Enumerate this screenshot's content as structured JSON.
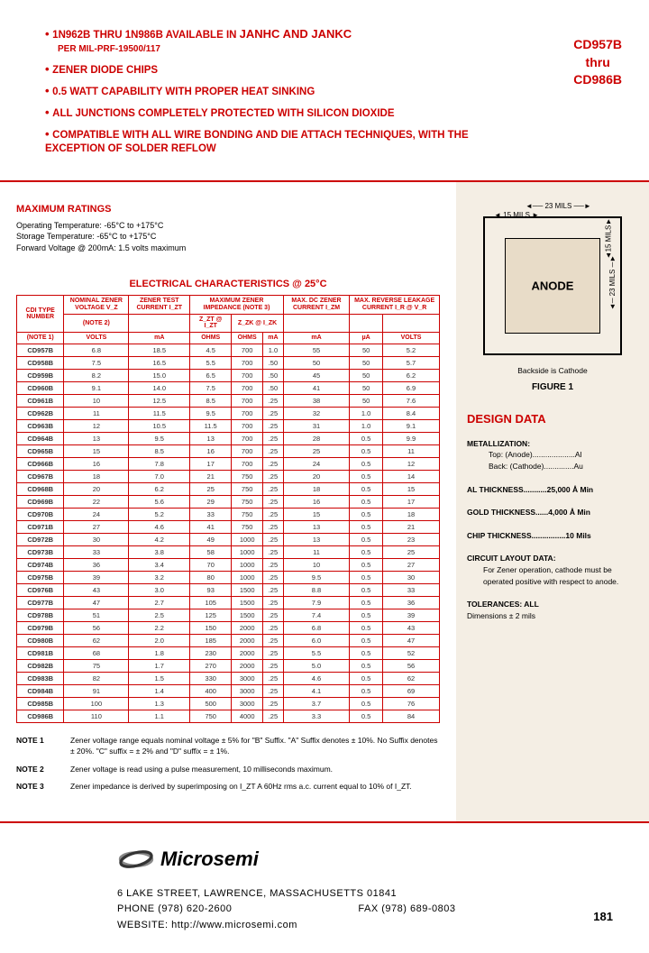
{
  "title": {
    "a": "CD957B",
    "b": "thru",
    "c": "CD986B"
  },
  "features": [
    "1N962B THRU 1N986B AVAILABLE IN JANHC AND JANKC PER MIL-PRF-19500/117",
    "ZENER DIODE CHIPS",
    "0.5 WATT CAPABILITY WITH PROPER HEAT SINKING",
    "ALL JUNCTIONS COMPLETELY PROTECTED WITH SILICON DIOXIDE",
    "COMPATIBLE WITH ALL WIRE BONDING AND DIE ATTACH TECHNIQUES, WITH THE EXCEPTION OF SOLDER REFLOW"
  ],
  "maxratings": {
    "h": "MAXIMUM RATINGS",
    "l1": "Operating Temperature: -65°C to +175°C",
    "l2": "Storage Temperature: -65°C to +175°C",
    "l3": "Forward Voltage @ 200mA: 1.5 volts maximum"
  },
  "ehdr": "ELECTRICAL CHARACTERISTICS @ 25°C",
  "thead": [
    "CDI TYPE NUMBER",
    "NOMINAL ZENER VOLTAGE V_Z",
    "ZENER TEST CURRENT I_ZT",
    "MAXIMUM ZENER IMPEDANCE (NOTE 3)",
    "",
    "MAX. DC ZENER CURRENT I_ZM",
    "MAX. REVERSE LEAKAGE CURRENT I_R @ V_R",
    ""
  ],
  "tsub": [
    "(NOTE 1)",
    "(NOTE 2)",
    "",
    "Z_ZT @ I_ZT",
    "Z_ZK @ I_ZK",
    "",
    "",
    ""
  ],
  "units": [
    "",
    "VOLTS",
    "mA",
    "OHMS",
    "OHMS",
    "mA",
    "mA",
    "µA",
    "VOLTS"
  ],
  "rows": [
    [
      "CD957B",
      "6.8",
      "18.5",
      "4.5",
      "700",
      "1.0",
      "55",
      "50",
      "5.2"
    ],
    [
      "CD958B",
      "7.5",
      "16.5",
      "5.5",
      "700",
      ".50",
      "50",
      "50",
      "5.7"
    ],
    [
      "CD959B",
      "8.2",
      "15.0",
      "6.5",
      "700",
      ".50",
      "45",
      "50",
      "6.2"
    ],
    [
      "CD960B",
      "9.1",
      "14.0",
      "7.5",
      "700",
      ".50",
      "41",
      "50",
      "6.9"
    ],
    [
      "CD961B",
      "10",
      "12.5",
      "8.5",
      "700",
      ".25",
      "38",
      "50",
      "7.6"
    ],
    [
      "CD962B",
      "11",
      "11.5",
      "9.5",
      "700",
      ".25",
      "32",
      "1.0",
      "8.4"
    ],
    [
      "CD963B",
      "12",
      "10.5",
      "11.5",
      "700",
      ".25",
      "31",
      "1.0",
      "9.1"
    ],
    [
      "CD964B",
      "13",
      "9.5",
      "13",
      "700",
      ".25",
      "28",
      "0.5",
      "9.9"
    ],
    [
      "CD965B",
      "15",
      "8.5",
      "16",
      "700",
      ".25",
      "25",
      "0.5",
      "11"
    ],
    [
      "CD966B",
      "16",
      "7.8",
      "17",
      "700",
      ".25",
      "24",
      "0.5",
      "12"
    ],
    [
      "CD967B",
      "18",
      "7.0",
      "21",
      "750",
      ".25",
      "20",
      "0.5",
      "14"
    ],
    [
      "CD968B",
      "20",
      "6.2",
      "25",
      "750",
      ".25",
      "18",
      "0.5",
      "15"
    ],
    [
      "CD969B",
      "22",
      "5.6",
      "29",
      "750",
      ".25",
      "16",
      "0.5",
      "17"
    ],
    [
      "CD970B",
      "24",
      "5.2",
      "33",
      "750",
      ".25",
      "15",
      "0.5",
      "18"
    ],
    [
      "CD971B",
      "27",
      "4.6",
      "41",
      "750",
      ".25",
      "13",
      "0.5",
      "21"
    ],
    [
      "CD972B",
      "30",
      "4.2",
      "49",
      "1000",
      ".25",
      "13",
      "0.5",
      "23"
    ],
    [
      "CD973B",
      "33",
      "3.8",
      "58",
      "1000",
      ".25",
      "11",
      "0.5",
      "25"
    ],
    [
      "CD974B",
      "36",
      "3.4",
      "70",
      "1000",
      ".25",
      "10",
      "0.5",
      "27"
    ],
    [
      "CD975B",
      "39",
      "3.2",
      "80",
      "1000",
      ".25",
      "9.5",
      "0.5",
      "30"
    ],
    [
      "CD976B",
      "43",
      "3.0",
      "93",
      "1500",
      ".25",
      "8.8",
      "0.5",
      "33"
    ],
    [
      "CD977B",
      "47",
      "2.7",
      "105",
      "1500",
      ".25",
      "7.9",
      "0.5",
      "36"
    ],
    [
      "CD978B",
      "51",
      "2.5",
      "125",
      "1500",
      ".25",
      "7.4",
      "0.5",
      "39"
    ],
    [
      "CD979B",
      "56",
      "2.2",
      "150",
      "2000",
      ".25",
      "6.8",
      "0.5",
      "43"
    ],
    [
      "CD980B",
      "62",
      "2.0",
      "185",
      "2000",
      ".25",
      "6.0",
      "0.5",
      "47"
    ],
    [
      "CD981B",
      "68",
      "1.8",
      "230",
      "2000",
      ".25",
      "5.5",
      "0.5",
      "52"
    ],
    [
      "CD982B",
      "75",
      "1.7",
      "270",
      "2000",
      ".25",
      "5.0",
      "0.5",
      "56"
    ],
    [
      "CD983B",
      "82",
      "1.5",
      "330",
      "3000",
      ".25",
      "4.6",
      "0.5",
      "62"
    ],
    [
      "CD984B",
      "91",
      "1.4",
      "400",
      "3000",
      ".25",
      "4.1",
      "0.5",
      "69"
    ],
    [
      "CD985B",
      "100",
      "1.3",
      "500",
      "3000",
      ".25",
      "3.7",
      "0.5",
      "76"
    ],
    [
      "CD986B",
      "110",
      "1.1",
      "750",
      "4000",
      ".25",
      "3.3",
      "0.5",
      "84"
    ]
  ],
  "notes": {
    "n1l": "NOTE 1",
    "n1": "Zener voltage range equals nominal voltage ± 5% for \"B\" Suffix. \"A\" Suffix denotes ± 10%. No Suffix denotes ± 20%. \"C\" suffix = ± 2% and \"D\" suffix = ± 1%.",
    "n2l": "NOTE 2",
    "n2": "Zener voltage is read using a pulse measurement, 10 milliseconds maximum.",
    "n3l": "NOTE 3",
    "n3": "Zener impedance is derived by superimposing on I_ZT A 60Hz rms a.c. current equal to 10% of I_ZT."
  },
  "chip": {
    "anode": "ANODE",
    "d23": "23 MILS",
    "d15": "15 MILS",
    "back": "Backside is Cathode",
    "fig": "FIGURE 1"
  },
  "design": {
    "h": "DESIGN DATA",
    "met": "METALLIZATION:",
    "met1": "Top: (Anode)....................Al",
    "met2": "Back: (Cathode)..............Au",
    "alt": "AL THICKNESS...........25,000 Å Min",
    "gt": "GOLD THICKNESS......4,000 Å Min",
    "ct": "CHIP THICKNESS................10 Mils",
    "cl": "CIRCUIT LAYOUT DATA:",
    "cl1": "For Zener operation, cathode must be operated positive with respect to anode.",
    "tol": "TOLERANCES: ALL",
    "tol1": "Dimensions ± 2 mils"
  },
  "footer": {
    "brand": "Microsemi",
    "addr": "6  LAKE  STREET,  LAWRENCE,  MASSACHUSETTS  01841",
    "phone": "PHONE (978) 620-2600",
    "fax": "FAX (978) 689-0803",
    "web": "WEBSITE:  http://www.microsemi.com",
    "page": "181"
  }
}
